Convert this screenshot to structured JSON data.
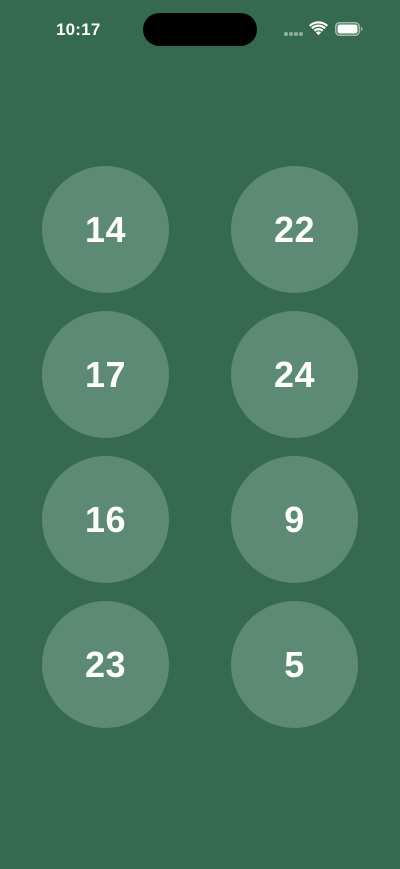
{
  "status_bar": {
    "time": "10:17",
    "icons": [
      "signal-dots-icon",
      "wifi-icon",
      "battery-icon"
    ]
  },
  "colors": {
    "background": "#356a51",
    "circle": "#5d8a74",
    "text": "#ffffff"
  },
  "circles": [
    {
      "label": "14"
    },
    {
      "label": "22"
    },
    {
      "label": "17"
    },
    {
      "label": "24"
    },
    {
      "label": "16"
    },
    {
      "label": "9"
    },
    {
      "label": "23"
    },
    {
      "label": "5"
    }
  ]
}
